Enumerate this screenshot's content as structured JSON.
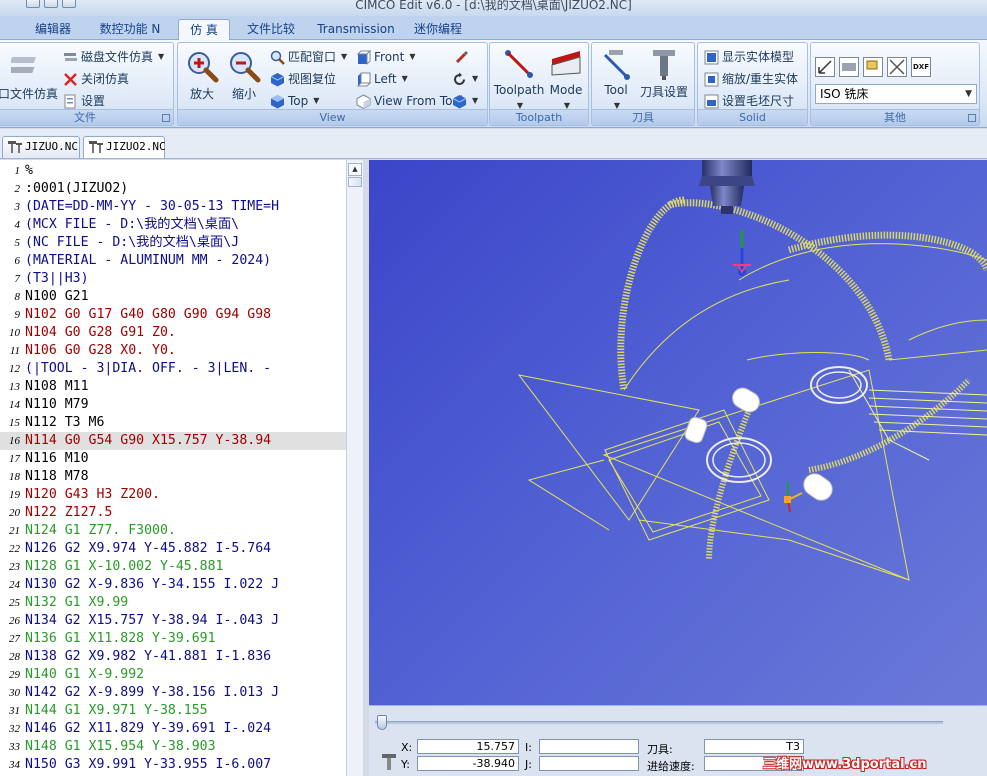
{
  "window": {
    "title": "CIMCO Edit v6.0 - [d:\\我的文档\\桌面\\JIZUO2.NC]"
  },
  "ribbon_tabs": [
    {
      "label": "编辑器",
      "active": false
    },
    {
      "label": "数控功能 N",
      "active": false
    },
    {
      "label": "仿 真",
      "active": true
    },
    {
      "label": "文件比较",
      "active": false
    },
    {
      "label": "Transmission",
      "active": false
    },
    {
      "label": "迷你编程",
      "active": false
    }
  ],
  "groups": {
    "file": {
      "title": "文件",
      "open_sim": "口文件仿真",
      "disk_sim": "磁盘文件仿真",
      "close_sim": "关闭仿真",
      "settings": "设置"
    },
    "view": {
      "title": "View",
      "zoom_in": "放大",
      "zoom_out": "缩小",
      "fit_window": "匹配窗口",
      "reset_view": "视图复位",
      "top": "Top",
      "front": "Front",
      "left": "Left",
      "view_from_tool": "View From Tool"
    },
    "toolpath": {
      "title": "Toolpath",
      "toolpath": "Toolpath",
      "mode": "Mode"
    },
    "tool": {
      "title": "刀具",
      "tool": "Tool",
      "tool_settings": "刀具设置"
    },
    "solid": {
      "title": "Solid",
      "show_solid": "显示实体模型",
      "zoom_regen": "缩放/重生实体",
      "set_stock": "设置毛坯尺寸"
    },
    "other": {
      "title": "其他",
      "machine_select": "ISO 铣床",
      "icon_labels": [
        "DXF"
      ]
    }
  },
  "doc_tabs": [
    {
      "label": "JIZUO.NC",
      "active": false
    },
    {
      "label": "JIZUO2.NC",
      "active": true
    }
  ],
  "colors": {
    "black": "#000000",
    "navy": "#0d0d8c",
    "red": "#a00000",
    "green": "#2a9a2a",
    "highlight": "#e0e0e0"
  },
  "code_lines": [
    {
      "n": "1",
      "text": "%",
      "color": "black"
    },
    {
      "n": "2",
      "text": ":0001(JIZUO2)",
      "color": "black"
    },
    {
      "n": "3",
      "text": "(DATE=DD-MM-YY - 30-05-13 TIME=H",
      "color": "navy"
    },
    {
      "n": "4",
      "text": "(MCX FILE - D:\\我的文档\\桌面\\",
      "color": "navy"
    },
    {
      "n": "5",
      "text": "(NC FILE - D:\\我的文档\\桌面\\J",
      "color": "navy"
    },
    {
      "n": "6",
      "text": "(MATERIAL - ALUMINUM MM - 2024)",
      "color": "navy"
    },
    {
      "n": "7",
      "text": "(T3||H3)",
      "color": "navy"
    },
    {
      "n": "8",
      "text": "N100 G21",
      "color": "black"
    },
    {
      "n": "9",
      "text": "N102 G0 G17 G40 G80 G90 G94 G98",
      "color": "red"
    },
    {
      "n": "10",
      "text": "N104 G0 G28 G91 Z0.",
      "color": "red"
    },
    {
      "n": "11",
      "text": "N106 G0 G28 X0. Y0.",
      "color": "red"
    },
    {
      "n": "12",
      "text": "(|TOOL - 3|DIA. OFF. - 3|LEN. -",
      "color": "navy"
    },
    {
      "n": "13",
      "text": "N108 M11",
      "color": "black"
    },
    {
      "n": "14",
      "text": "N110 M79",
      "color": "black"
    },
    {
      "n": "15",
      "text": "N112 T3 M6",
      "color": "black"
    },
    {
      "n": "16",
      "text": "N114 G0 G54 G90 X15.757 Y-38.94",
      "color": "red",
      "highlight": true
    },
    {
      "n": "17",
      "text": "N116 M10",
      "color": "black"
    },
    {
      "n": "18",
      "text": "N118 M78",
      "color": "black"
    },
    {
      "n": "19",
      "text": "N120 G43 H3 Z200.",
      "color": "red"
    },
    {
      "n": "20",
      "text": "N122 Z127.5",
      "color": "red"
    },
    {
      "n": "21",
      "text": "N124 G1 Z77. F3000.",
      "color": "green"
    },
    {
      "n": "22",
      "text": "N126 G2 X9.974 Y-45.882 I-5.764",
      "color": "navy"
    },
    {
      "n": "23",
      "text": "N128 G1 X-10.002 Y-45.881",
      "color": "green"
    },
    {
      "n": "24",
      "text": "N130 G2 X-9.836 Y-34.155 I.022 J",
      "color": "navy"
    },
    {
      "n": "25",
      "text": "N132 G1 X9.99",
      "color": "green"
    },
    {
      "n": "26",
      "text": "N134 G2 X15.757 Y-38.94 I-.043 J",
      "color": "navy"
    },
    {
      "n": "27",
      "text": "N136 G1 X11.828 Y-39.691",
      "color": "green"
    },
    {
      "n": "28",
      "text": "N138 G2 X9.982 Y-41.881 I-1.836",
      "color": "navy"
    },
    {
      "n": "29",
      "text": "N140 G1 X-9.992",
      "color": "green"
    },
    {
      "n": "30",
      "text": "N142 G2 X-9.899 Y-38.156 I.013 J",
      "color": "navy"
    },
    {
      "n": "31",
      "text": "N144 G1 X9.971 Y-38.155",
      "color": "green"
    },
    {
      "n": "32",
      "text": "N146 G2 X11.829 Y-39.691 I-.024",
      "color": "navy"
    },
    {
      "n": "33",
      "text": "N148 G1 X15.954 Y-38.903",
      "color": "green"
    },
    {
      "n": "34",
      "text": "N150 G3 X9.991 Y-33.955 I-6.007",
      "color": "navy"
    }
  ],
  "status": {
    "x_label": "X:",
    "x_value": "15.757",
    "y_label": "Y:",
    "y_value": "-38.940",
    "i_label": "I:",
    "i_value": "",
    "j_label": "J:",
    "j_value": "",
    "tool_label": "刀具:",
    "tool_value": "T3",
    "feed_label": "进给速度:",
    "feed_value": ""
  },
  "watermark": "三维网www.3dportal.cn"
}
